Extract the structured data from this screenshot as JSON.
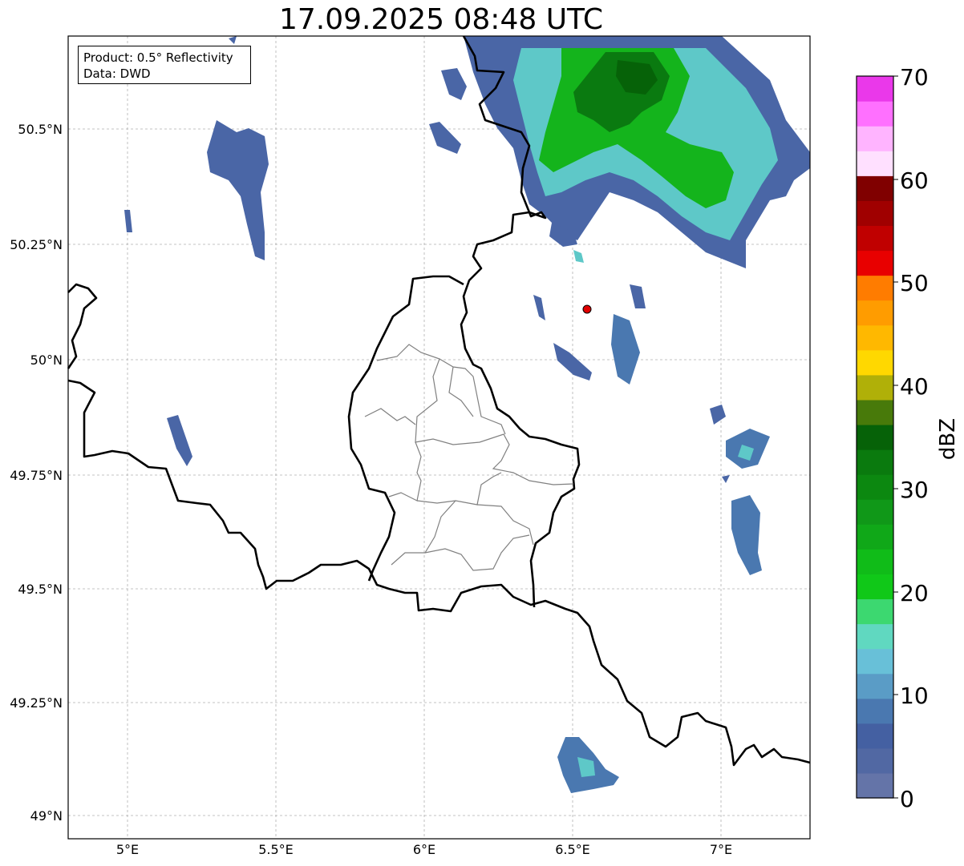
{
  "title": "17.09.2025 08:48 UTC",
  "info": {
    "product": "Product: 0.5° Reflectivity",
    "data": "Data: DWD"
  },
  "map": {
    "lon_ticks": [
      "5°E",
      "5.5°E",
      "6°E",
      "6.5°E",
      "7°E"
    ],
    "lat_ticks": [
      "50.5°N",
      "50.25°N",
      "50°N",
      "49.75°N",
      "49.5°N",
      "49.25°N",
      "49°N"
    ],
    "lon_range": [
      4.8,
      7.3
    ],
    "lat_range": [
      48.95,
      50.7
    ],
    "radar_site_marker": {
      "lon": 6.55,
      "lat": 50.11,
      "color": "#e00000"
    }
  },
  "colorbar": {
    "label": "dBZ",
    "range": [
      0,
      70
    ],
    "ticks": [
      "70",
      "60",
      "50",
      "40",
      "30",
      "20",
      "10",
      "0"
    ],
    "colors": [
      "#6474a8",
      "#5168a3",
      "#4460a2",
      "#4a78b0",
      "#5a9cc6",
      "#68c0d8",
      "#60d8c0",
      "#3cd870",
      "#10c818",
      "#10bc18",
      "#10a818",
      "#109818",
      "#0c8810",
      "#0a7a0e",
      "#066208",
      "#487a0a",
      "#b0b008",
      "#ffd800",
      "#ffb800",
      "#ff9c00",
      "#ff7c00",
      "#e80000",
      "#c00000",
      "#a00000",
      "#800000",
      "#ffe0ff",
      "#ffb4ff",
      "#ff70ff",
      "#ea38ea"
    ]
  }
}
